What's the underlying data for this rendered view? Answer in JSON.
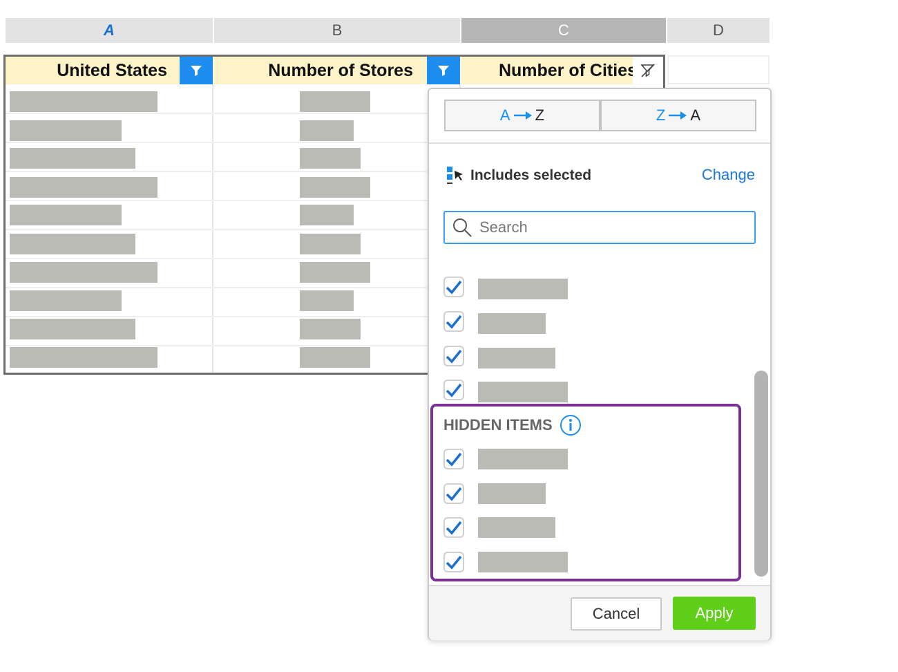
{
  "columns": {
    "a": "A",
    "b": "B",
    "c": "C",
    "d": "D"
  },
  "table": {
    "headers": [
      "United States",
      "Number of Stores",
      "Number of Cities"
    ]
  },
  "colors": {
    "filter_button": "#1d8ef0",
    "header_fill": "#fdf3c9",
    "accent_blue": "#1a78d6",
    "hidden_outline": "#7b2f97",
    "apply_green": "#5fcf1a"
  },
  "filter_dropdown": {
    "sort_asc": {
      "from": "A",
      "to": "Z"
    },
    "sort_desc": {
      "from": "Z",
      "to": "A"
    },
    "mode_label": "Includes selected",
    "change_link": "Change",
    "search_placeholder": "Search",
    "visible_items_checked": [
      true,
      true,
      true,
      true
    ],
    "hidden_items_title": "HIDDEN ITEMS",
    "hidden_items_checked": [
      true,
      true,
      true,
      true
    ],
    "cancel_label": "Cancel",
    "apply_label": "Apply",
    "icons": [
      "filter-icon",
      "filter-clear-icon",
      "arrow-right-icon",
      "cursor-select-icon",
      "search-icon",
      "info-icon",
      "checkmark-icon"
    ]
  }
}
